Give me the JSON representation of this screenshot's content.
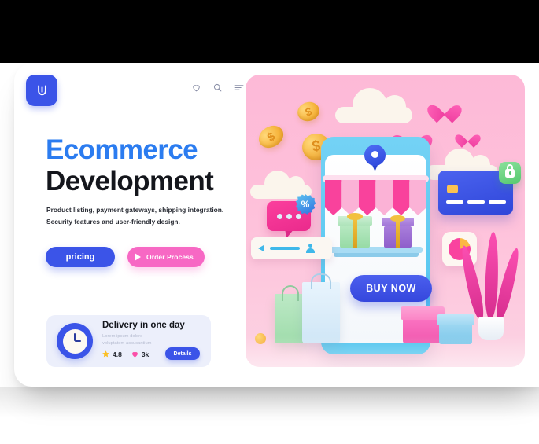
{
  "brand": {
    "logo_icon": "power-u-icon",
    "logo_color": "#3b54e8"
  },
  "nav": {
    "icons": [
      {
        "name": "wishlist-heart-icon",
        "glyph": "heart"
      },
      {
        "name": "search-icon",
        "glyph": "magnifier"
      },
      {
        "name": "menu-icon",
        "glyph": "hamburger"
      }
    ]
  },
  "hero": {
    "headline_line1": "Ecommerce",
    "headline_line2": "Development",
    "headline_line1_color": "#2b7cf0",
    "headline_line2_color": "#14161c",
    "subcopy_line1": "Product listing, payment gateways, shipping integration.",
    "subcopy_line2": "Security features and user-friendly design.",
    "primary_button": "pricing",
    "secondary_button": "Order Process",
    "primary_button_color": "#3b54e8",
    "secondary_button_color": "#f768c4"
  },
  "delivery_card": {
    "icon": "clock-icon",
    "title": "Delivery in one day",
    "sub_line1": "Lorem ipsum dolore",
    "sub_line2": "voluptatem accusantium",
    "rating_value": "4.8",
    "likes_value": "3k",
    "details_button": "Details",
    "card_bg": "#eceffb"
  },
  "illustration": {
    "panel_color": "#fdb9d7",
    "buy_now_label": "BUY NOW",
    "discount_badge": "%",
    "coin_symbol": "$",
    "objects": [
      "cloud",
      "cloud",
      "cloud",
      "gold-coin",
      "gold-coin",
      "gold-coin",
      "heart",
      "heart",
      "heart",
      "smartphone",
      "location-pin",
      "shop-awning",
      "gift-box-green",
      "gift-box-purple",
      "shelf",
      "buy-now-button",
      "chat-bubble",
      "discount-badge",
      "search-field",
      "credit-card",
      "lock-badge",
      "pie-chart-card",
      "potted-plant",
      "shopping-bag-green",
      "shopping-bag-blue",
      "gift-box-pink",
      "gift-box-blue",
      "small-ball"
    ]
  }
}
